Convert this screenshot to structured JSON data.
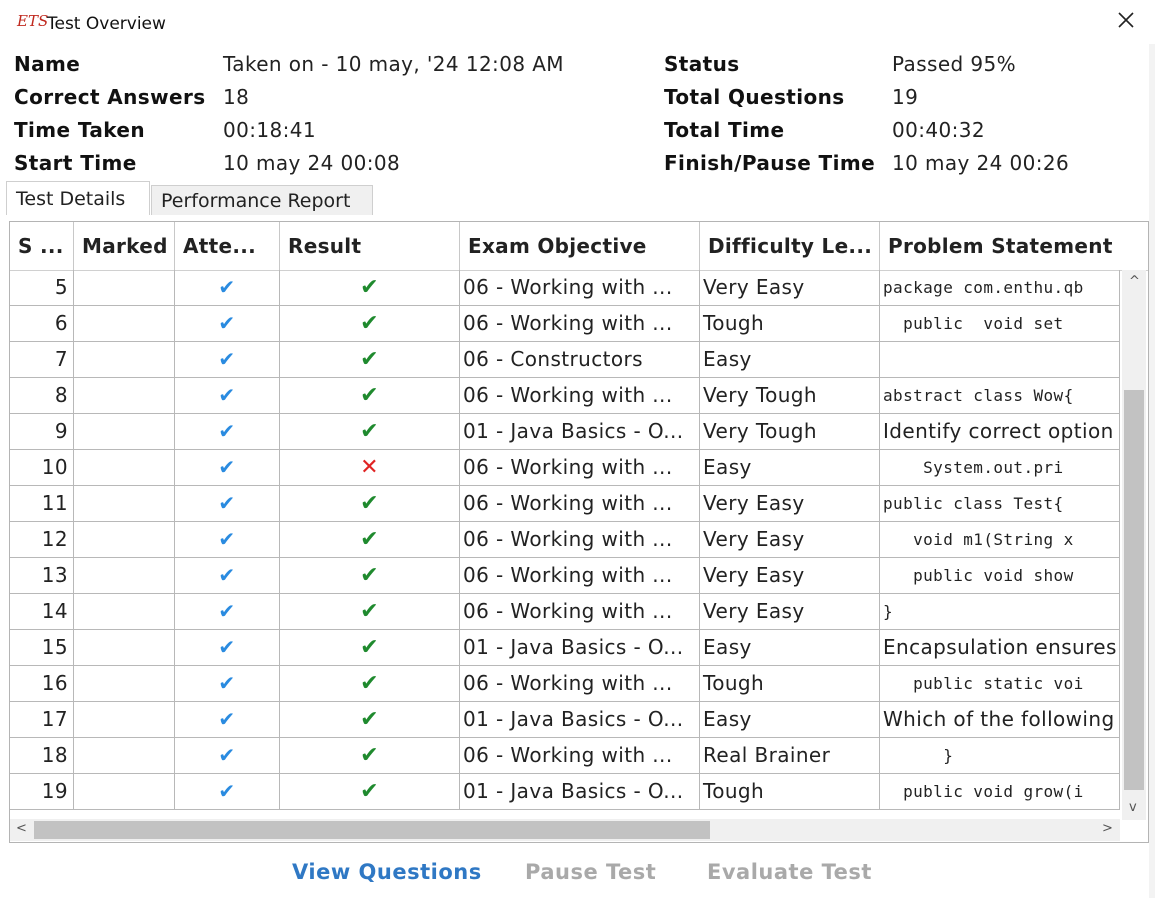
{
  "window": {
    "logo": "ETS",
    "title": "Test Overview",
    "close_icon": "close-icon"
  },
  "summary": {
    "name_label": "Name",
    "name_value": "Taken on - 10 may, '24 12:08 AM",
    "correct_label": "Correct Answers",
    "correct_value": "18",
    "time_taken_label": "Time Taken",
    "time_taken_value": "00:18:41",
    "start_label": "Start Time",
    "start_value": "10 may 24 00:08",
    "status_label": "Status",
    "status_value": "Passed 95%",
    "total_q_label": "Total Questions",
    "total_q_value": "19",
    "total_time_label": "Total Time",
    "total_time_value": "00:40:32",
    "finish_label": "Finish/Pause Time",
    "finish_value": "10 may 24 00:26"
  },
  "tabs": [
    {
      "label": "Test Details",
      "active": true
    },
    {
      "label": "Performance Report",
      "active": false
    }
  ],
  "table": {
    "headers": [
      "S ...",
      "Marked",
      "Atte...",
      "Result",
      "Exam Objective",
      "Difficulty Le...",
      "Problem Statement"
    ],
    "rows": [
      {
        "sn": "5",
        "marked": "",
        "attempted": "check",
        "result": "correct",
        "objective": "06 - Working with ...",
        "difficulty": "Very Easy",
        "problem": "package com.enthu.qb",
        "mono": true
      },
      {
        "sn": "6",
        "marked": "",
        "attempted": "check",
        "result": "correct",
        "objective": "06 - Working with ...",
        "difficulty": "Tough",
        "problem": "  public  void set",
        "mono": true
      },
      {
        "sn": "7",
        "marked": "",
        "attempted": "check",
        "result": "correct",
        "objective": "06 - Constructors",
        "difficulty": "Easy",
        "problem": "",
        "mono": true
      },
      {
        "sn": "8",
        "marked": "",
        "attempted": "check",
        "result": "correct",
        "objective": "06 - Working with ...",
        "difficulty": "Very Tough",
        "problem": "abstract class Wow{",
        "mono": true
      },
      {
        "sn": "9",
        "marked": "",
        "attempted": "check",
        "result": "correct",
        "objective": "01 - Java Basics - O...",
        "difficulty": "Very Tough",
        "problem": "Identify correct option",
        "mono": false
      },
      {
        "sn": "10",
        "marked": "",
        "attempted": "check",
        "result": "wrong",
        "objective": "06 - Working with ...",
        "difficulty": "Easy",
        "problem": "    System.out.pri",
        "mono": true
      },
      {
        "sn": "11",
        "marked": "",
        "attempted": "check",
        "result": "correct",
        "objective": "06 - Working with ...",
        "difficulty": "Very Easy",
        "problem": "public class Test{",
        "mono": true
      },
      {
        "sn": "12",
        "marked": "",
        "attempted": "check",
        "result": "correct",
        "objective": "06 - Working with ...",
        "difficulty": "Very Easy",
        "problem": "   void m1(String x",
        "mono": true
      },
      {
        "sn": "13",
        "marked": "",
        "attempted": "check",
        "result": "correct",
        "objective": "06 - Working with ...",
        "difficulty": "Very Easy",
        "problem": "   public void show",
        "mono": true
      },
      {
        "sn": "14",
        "marked": "",
        "attempted": "check",
        "result": "correct",
        "objective": "06 - Working with ...",
        "difficulty": "Very Easy",
        "problem": "}",
        "mono": true
      },
      {
        "sn": "15",
        "marked": "",
        "attempted": "check",
        "result": "correct",
        "objective": "01 - Java Basics - O...",
        "difficulty": "Easy",
        "problem": "Encapsulation ensures",
        "mono": false
      },
      {
        "sn": "16",
        "marked": "",
        "attempted": "check",
        "result": "correct",
        "objective": "06 - Working with ...",
        "difficulty": "Tough",
        "problem": "   public static voi",
        "mono": true
      },
      {
        "sn": "17",
        "marked": "",
        "attempted": "check",
        "result": "correct",
        "objective": "01 - Java Basics - O...",
        "difficulty": "Easy",
        "problem": "Which of the following",
        "mono": false
      },
      {
        "sn": "18",
        "marked": "",
        "attempted": "check",
        "result": "correct",
        "objective": "06 - Working with ...",
        "difficulty": "Real Brainer",
        "problem": "      }",
        "mono": true
      },
      {
        "sn": "19",
        "marked": "",
        "attempted": "check",
        "result": "correct",
        "objective": "01 - Java Basics - O...",
        "difficulty": "Tough",
        "problem": "  public void grow(i",
        "mono": true
      }
    ]
  },
  "icons": {
    "attempted": "✔",
    "correct": "✔",
    "wrong": "✕",
    "scroll_up": "^",
    "scroll_down": "v",
    "scroll_left": "<",
    "scroll_right": ">"
  },
  "colors": {
    "attempted_check": "#2a8be0",
    "correct_check": "#1f8a2e",
    "wrong_cross": "#e02424",
    "link_active": "#2f78c4",
    "button_disabled": "#a9a9a9",
    "logo": "#c0281e"
  },
  "footer": {
    "view_questions": "View Questions",
    "pause_test": "Pause Test",
    "evaluate_test": "Evaluate Test"
  }
}
